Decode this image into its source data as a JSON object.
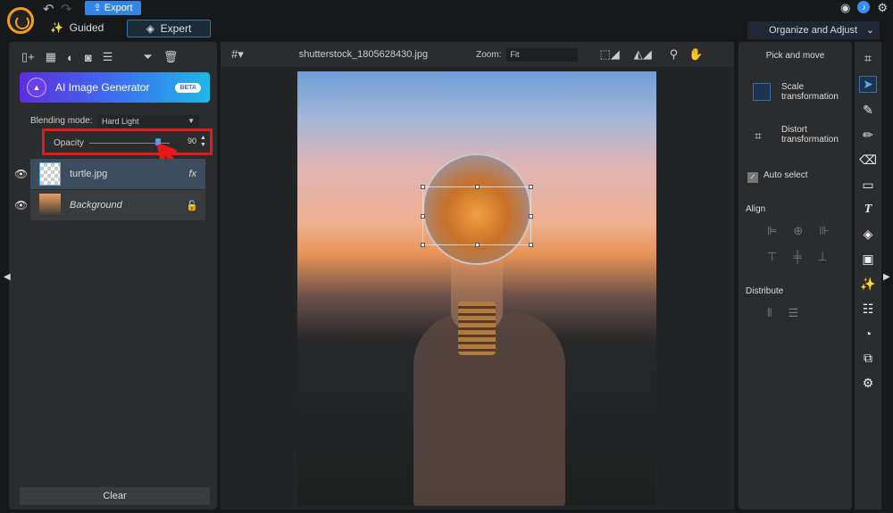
{
  "header": {
    "export_label": "Export",
    "guided_label": "Guided",
    "expert_label": "Expert",
    "workspace": "Organize and Adjust"
  },
  "layers": {
    "ai_label": "AI Image Generator",
    "beta": "BETA",
    "blending_label": "Blending mode:",
    "blending_value": "Hard Light",
    "opacity_label": "Opacity",
    "opacity_value": "90",
    "opacity_fraction": 0.9,
    "items": [
      {
        "name": "turtle.jpg",
        "fx": "fx"
      },
      {
        "name": "Background"
      }
    ],
    "clear_label": "Clear"
  },
  "canvas": {
    "filename": "shutterstock_1805628430.jpg",
    "zoom_label": "Zoom:",
    "zoom_value": "Fit"
  },
  "tools": {
    "title": "Pick and move",
    "scale": "Scale transformation",
    "distort": "Distort transformation",
    "auto_select": "Auto select",
    "align": "Align",
    "distribute": "Distribute"
  }
}
